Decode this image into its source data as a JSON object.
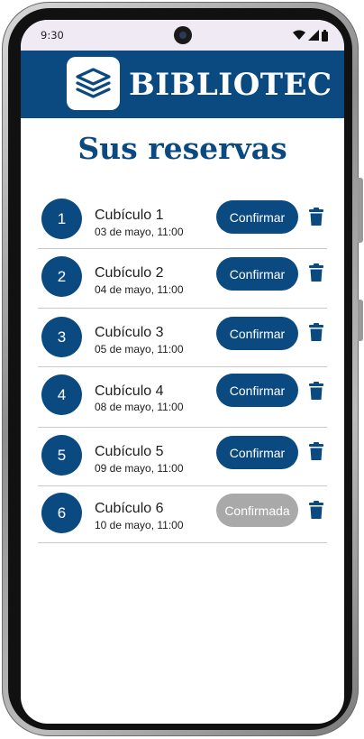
{
  "status": {
    "time": "9:30",
    "icons": [
      "wifi-icon",
      "signal-icon",
      "battery-icon"
    ]
  },
  "header": {
    "brand": "BIBLIOTEC",
    "logo_icon": "books-stack-icon"
  },
  "page": {
    "title": "Sus reservas"
  },
  "reservations": [
    {
      "number": "1",
      "title": "Cubículo 1",
      "date": "03 de mayo, 11:00",
      "action": "Confirmar",
      "state": "pending"
    },
    {
      "number": "2",
      "title": "Cubículo 2",
      "date": "04 de mayo, 11:00",
      "action": "Confirmar",
      "state": "pending"
    },
    {
      "number": "3",
      "title": "Cubículo 3",
      "date": "05 de mayo, 11:00",
      "action": "Confirmar",
      "state": "pending"
    },
    {
      "number": "4",
      "title": "Cubículo 4",
      "date": "08 de mayo, 11:00",
      "action": "Confirmar",
      "state": "pending"
    },
    {
      "number": "5",
      "title": "Cubículo 5",
      "date": "09 de mayo, 11:00",
      "action": "Confirmar",
      "state": "pending"
    },
    {
      "number": "6",
      "title": "Cubículo 6",
      "date": "10 de mayo, 11:00",
      "action": "Confirmada",
      "state": "confirmed"
    }
  ],
  "colors": {
    "primary": "#0b4a80",
    "confirmed_button": "#a9a9a9",
    "divider": "#c9c9c9",
    "status_bar": "#efeaf4"
  }
}
